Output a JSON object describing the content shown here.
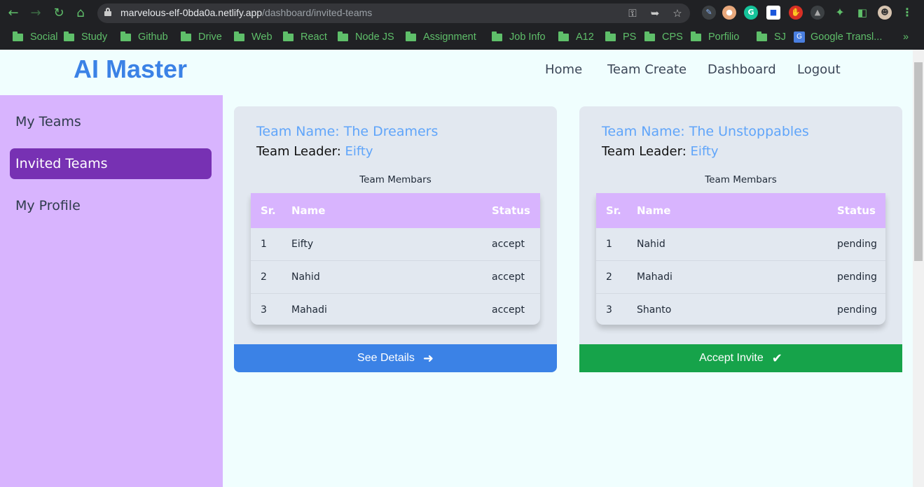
{
  "browser": {
    "url_host": "marvelous-elf-0bda0a.netlify.app",
    "url_path": "/dashboard/invited-teams",
    "bookmarks": [
      "Social",
      "Study",
      "Github",
      "Drive",
      "Web",
      "React",
      "Node JS",
      "Assignment",
      "Job Info",
      "A12",
      "PS",
      "CPS",
      "Porfilio",
      "SJ"
    ],
    "google_translate_label": "Google Transl...",
    "more_bookmarks": "»"
  },
  "app": {
    "logo": "AI Master",
    "nav": [
      "Home",
      "Team Create",
      "Dashboard",
      "Logout"
    ]
  },
  "sidebar": {
    "items": [
      {
        "label": "My Teams",
        "active": false
      },
      {
        "label": "Invited Teams",
        "active": true
      },
      {
        "label": "My Profile",
        "active": false
      }
    ]
  },
  "cards": [
    {
      "title": "Team Name: The Dreamers",
      "leader_label": "Team Leader: ",
      "leader_name": "Eifty",
      "members_caption": "Team Membars",
      "headers": [
        "Sr.",
        "Name",
        "Status"
      ],
      "rows": [
        {
          "sr": "1",
          "name": "Eifty",
          "status": "accept"
        },
        {
          "sr": "2",
          "name": "Nahid",
          "status": "accept"
        },
        {
          "sr": "3",
          "name": "Mahadi",
          "status": "accept"
        }
      ],
      "button_label": "See Details",
      "button_icon": "arrow-right-icon",
      "button_color": "#3b82e6"
    },
    {
      "title": "Team Name: The Unstoppables",
      "leader_label": "Team Leader: ",
      "leader_name": "Eifty",
      "members_caption": "Team Membars",
      "headers": [
        "Sr.",
        "Name",
        "Status"
      ],
      "rows": [
        {
          "sr": "1",
          "name": "Nahid",
          "status": "pending"
        },
        {
          "sr": "2",
          "name": "Mahadi",
          "status": "pending"
        },
        {
          "sr": "3",
          "name": "Shanto",
          "status": "pending"
        }
      ],
      "button_label": "Accept Invite",
      "button_icon": "check-icon",
      "button_color": "#16a34a"
    }
  ],
  "colors": {
    "brand": "#3b82e6",
    "sidebar_bg": "#d8b4fe",
    "sidebar_active": "#7731b3",
    "accept_green": "#16a34a"
  }
}
